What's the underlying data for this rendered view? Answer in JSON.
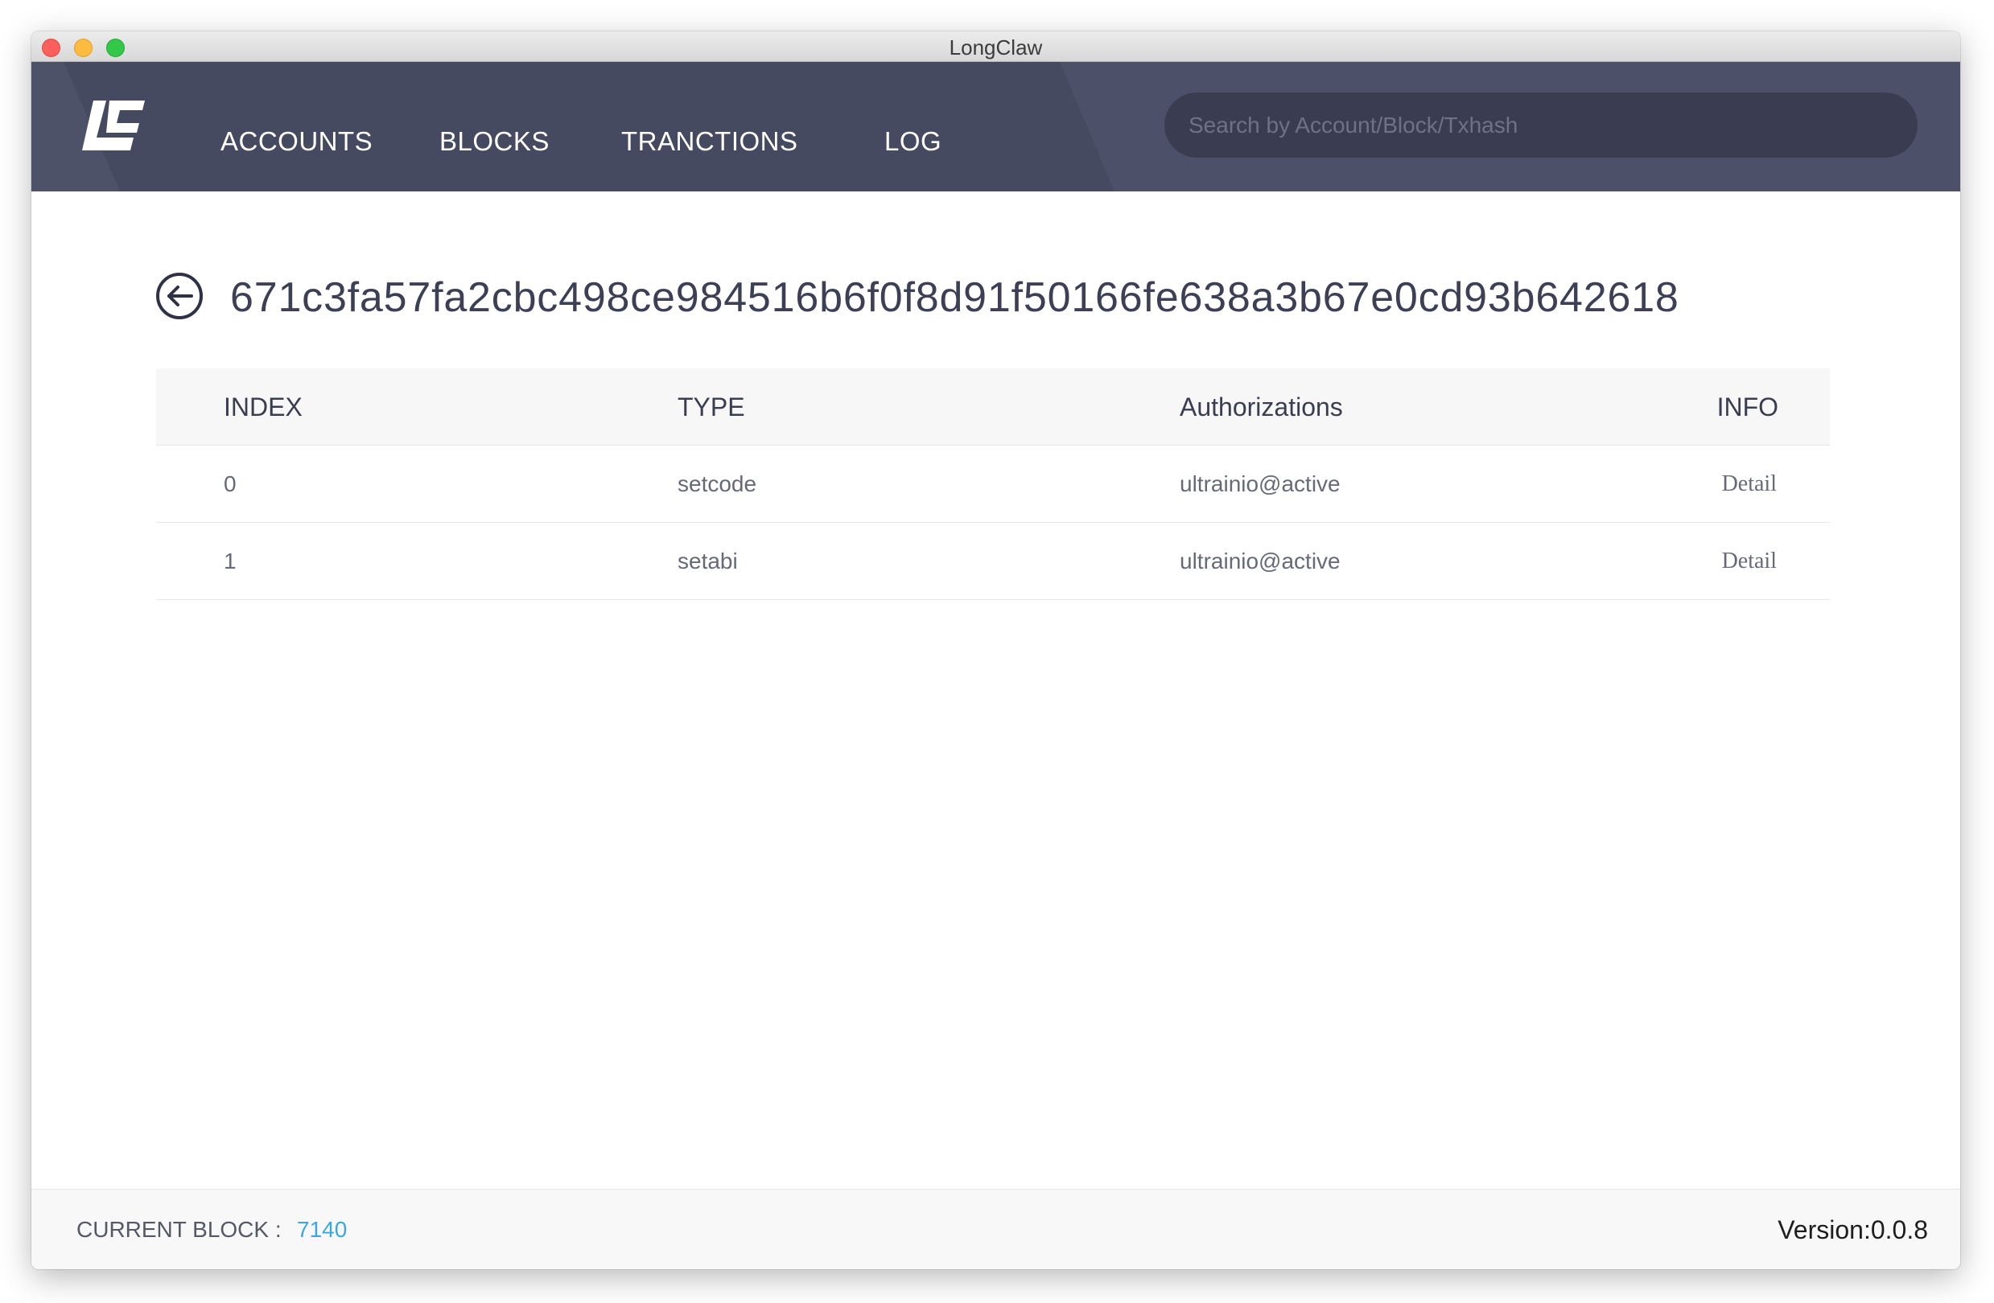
{
  "window": {
    "title": "LongClaw"
  },
  "header": {
    "logo": "longclaw-logo-icon",
    "nav": [
      {
        "label": "ACCOUNTS"
      },
      {
        "label": "BLOCKS"
      },
      {
        "label": "TRANCTIONS"
      },
      {
        "label": "LOG"
      }
    ],
    "search": {
      "placeholder": "Search by Account/Block/Txhash",
      "value": ""
    }
  },
  "transaction": {
    "back_icon": "arrow-left-circle-icon",
    "hash": "671c3fa57fa2cbc498ce984516b6f0f8d91f50166fe638a3b67e0cd93b642618"
  },
  "table": {
    "columns": [
      "INDEX",
      "TYPE",
      "Authorizations",
      "INFO"
    ],
    "rows": [
      {
        "index": "0",
        "type": "setcode",
        "authorization": "ultrainio@active",
        "info": "Detail"
      },
      {
        "index": "1",
        "type": "setabi",
        "authorization": "ultrainio@active",
        "info": "Detail"
      }
    ]
  },
  "footer": {
    "current_block_label": "CURRENT BLOCK :",
    "current_block_value": "7140",
    "version": "Version:0.0.8"
  },
  "colors": {
    "header_bg": "#4a4e65",
    "search_bg": "#3a3d52",
    "link": "#3ba8dc",
    "text_dark": "#3d4055"
  }
}
